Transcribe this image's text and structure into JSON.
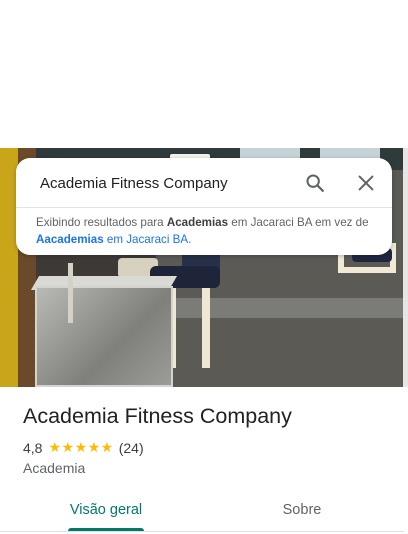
{
  "search": {
    "query": "Academia Fitness Company",
    "notice_prefix": "Exibindo resultados para ",
    "notice_term": "Academias",
    "notice_middle": " em Jacaraci BA em vez de ",
    "notice_alt_term": "Aacademias",
    "notice_alt_suffix": " em Jacaraci BA",
    "notice_end": "."
  },
  "place": {
    "title": "Academia Fitness Company",
    "rating": "4,8",
    "stars": "★★★★★",
    "reviews": "(24)",
    "category": "Academia"
  },
  "tabs": [
    {
      "label": "Visão geral",
      "active": true
    },
    {
      "label": "Sobre",
      "active": false
    }
  ],
  "colors": {
    "accent": "#00796b",
    "link": "#1a73e8",
    "star": "#fbbc04"
  },
  "icons": [
    "search-icon",
    "close-icon"
  ]
}
